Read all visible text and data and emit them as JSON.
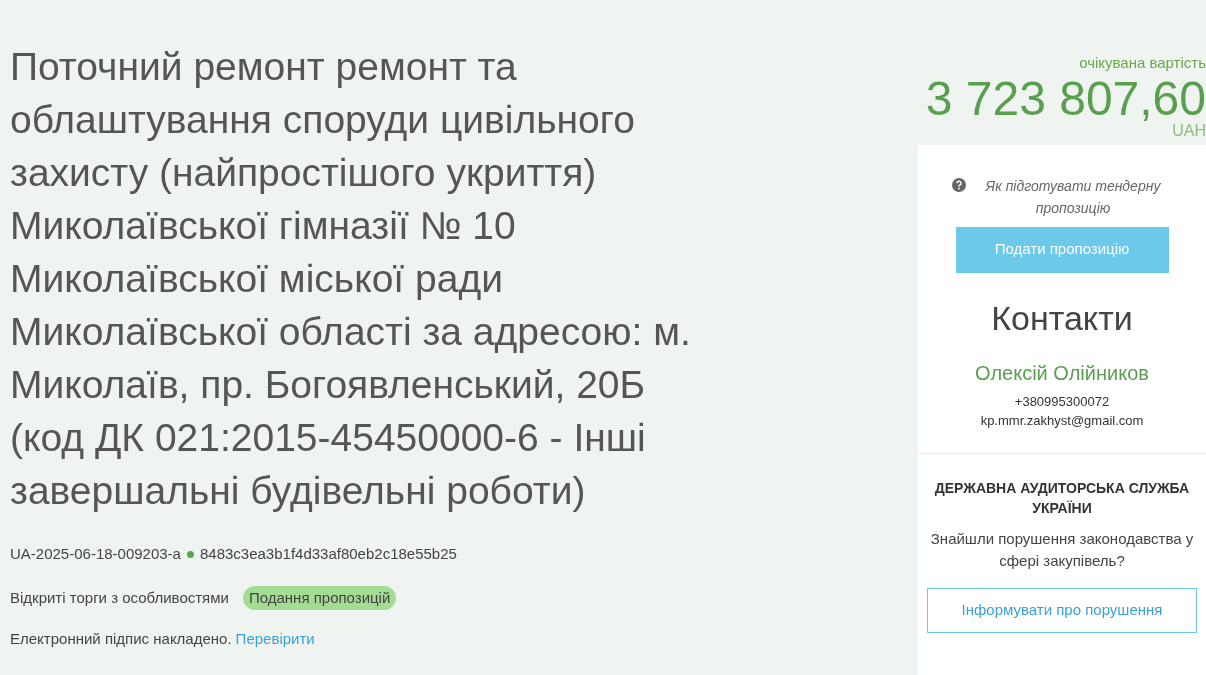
{
  "title": "Поточний ремонт ремонт та облаштування споруди цивільного захисту (найпростішого укриття) Миколаївської гімназії № 10 Миколаївської міської ради Миколаївської області за адресою: м. Миколаїв, пр. Богоявленський, 20Б (код ДК 021:2015-45450000-6 - Інші завершальні будівельні роботи)",
  "tender_id": "UA-2025-06-18-009203-a",
  "hash": "8483c3ea3b1f4d33af80eb2c18e55b25",
  "procedure": "Відкриті торги з особливостями",
  "status": {
    "label": "Подання пропозицій",
    "color": "#a3dc92"
  },
  "signature": {
    "text": "Електронний підпис накладено.",
    "link": "Перевірити"
  },
  "price": {
    "label": "очікувана вартість",
    "amount": "3 723 807,60",
    "currency": "UAH"
  },
  "sidebar": {
    "help_link": "Як підготувати тендерну пропозицію",
    "submit_button": "Подати пропозицію",
    "contacts_title": "Контакти",
    "contact_name": "Олексій Олійников",
    "phone": "+380995300072",
    "email": "kp.mmr.zakhyst@gmail.com",
    "audit_title": "ДЕРЖАВНА АУДИТОРСЬКА СЛУЖБА УКРАЇНИ",
    "audit_question": "Знайшли порушення законодавства у сфері закупівель?",
    "report_button": "Інформувати про порушення"
  }
}
